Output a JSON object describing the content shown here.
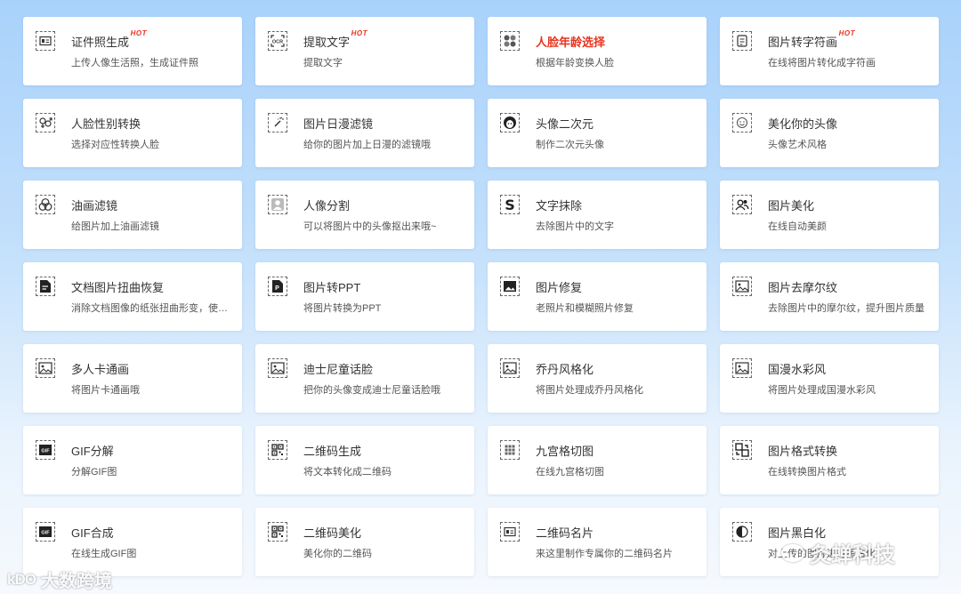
{
  "cards": [
    {
      "title": "证件照生成",
      "hot": "HOT",
      "desc": "上传人像生活照，生成证件照",
      "icon": "id-card-icon",
      "name": "id-photo"
    },
    {
      "title": "提取文字",
      "hot": "HOT",
      "desc": "提取文字",
      "icon": "ocr-icon",
      "name": "extract-text"
    },
    {
      "title": "人脸年龄选择",
      "desc": "根据年龄变换人脸",
      "icon": "face-grid-icon",
      "name": "face-age",
      "red": true
    },
    {
      "title": "图片转字符画",
      "hot": "HOT",
      "desc": "在线将图片转化成字符画",
      "icon": "document-icon",
      "name": "char-art"
    },
    {
      "title": "人脸性别转换",
      "desc": "选择对应性转换人脸",
      "icon": "gender-icon",
      "name": "gender-swap"
    },
    {
      "title": "图片日漫滤镜",
      "desc": "给你的图片加上日漫的滤镜哦",
      "icon": "magic-wand-icon",
      "name": "anime-filter"
    },
    {
      "title": "头像二次元",
      "desc": "制作二次元头像",
      "icon": "anime-avatar-icon",
      "name": "anime-avatar"
    },
    {
      "title": "美化你的头像",
      "desc": "头像艺术风格",
      "icon": "smiley-icon",
      "name": "beautify-avatar"
    },
    {
      "title": "油画滤镜",
      "desc": "给图片加上油画滤镜",
      "icon": "circles-icon",
      "name": "oil-filter"
    },
    {
      "title": "人像分割",
      "desc": "可以将图片中的头像抠出来哦~",
      "icon": "person-icon",
      "name": "portrait-segment"
    },
    {
      "title": "文字抹除",
      "desc": "去除图片中的文字",
      "icon": "letter-s-icon",
      "name": "text-erase"
    },
    {
      "title": "图片美化",
      "desc": "在线自动美颜",
      "icon": "people-icon",
      "name": "image-beautify"
    },
    {
      "title": "文档图片扭曲恢复",
      "desc": "消除文档图像的纸张扭曲形变，使文档图像恢复平整",
      "icon": "doc-fix-icon",
      "name": "doc-dewarp"
    },
    {
      "title": "图片转PPT",
      "desc": "将图片转换为PPT",
      "icon": "ppt-icon",
      "name": "image-to-ppt"
    },
    {
      "title": "图片修复",
      "desc": "老照片和模糊照片修复",
      "icon": "photo-fill-icon",
      "name": "image-repair"
    },
    {
      "title": "图片去摩尔纹",
      "desc": "去除图片中的摩尔纹，提升图片质量",
      "icon": "image-icon",
      "name": "remove-moire"
    },
    {
      "title": "多人卡通画",
      "desc": "将图片卡通画哦",
      "icon": "image-icon",
      "name": "multi-cartoon"
    },
    {
      "title": "迪士尼童话脸",
      "desc": "把你的头像变成迪士尼童话脸哦",
      "icon": "image-icon",
      "name": "disney-face"
    },
    {
      "title": "乔丹风格化",
      "desc": "将图片处理成乔丹风格化",
      "icon": "image-icon",
      "name": "jordan-style"
    },
    {
      "title": "国漫水彩风",
      "desc": "将图片处理成国漫水彩风",
      "icon": "image-icon",
      "name": "watercolor-style"
    },
    {
      "title": "GIF分解",
      "desc": "分解GIF图",
      "icon": "gif-icon",
      "name": "gif-split"
    },
    {
      "title": "二维码生成",
      "desc": "将文本转化成二维码",
      "icon": "qr-icon",
      "name": "qr-generate"
    },
    {
      "title": "九宫格切图",
      "desc": "在线九宫格切图",
      "icon": "nine-grid-icon",
      "name": "nine-grid"
    },
    {
      "title": "图片格式转换",
      "desc": "在线转换图片格式",
      "icon": "convert-icon",
      "name": "format-convert"
    },
    {
      "title": "GIF合成",
      "desc": "在线生成GIF图",
      "icon": "gif-icon",
      "name": "gif-compose"
    },
    {
      "title": "二维码美化",
      "desc": "美化你的二维码",
      "icon": "qr-icon",
      "name": "qr-beautify"
    },
    {
      "title": "二维码名片",
      "desc": "来这里制作专属你的二维码名片",
      "icon": "id-card-icon",
      "name": "qr-card"
    },
    {
      "title": "图片黑白化",
      "desc": "对上传的图片进行黑白化",
      "icon": "contrast-icon",
      "name": "grayscale"
    }
  ],
  "watermarks": {
    "left_logo": "大数跨境",
    "left_mark": "kDO",
    "right_text": "灸蝉科技"
  }
}
